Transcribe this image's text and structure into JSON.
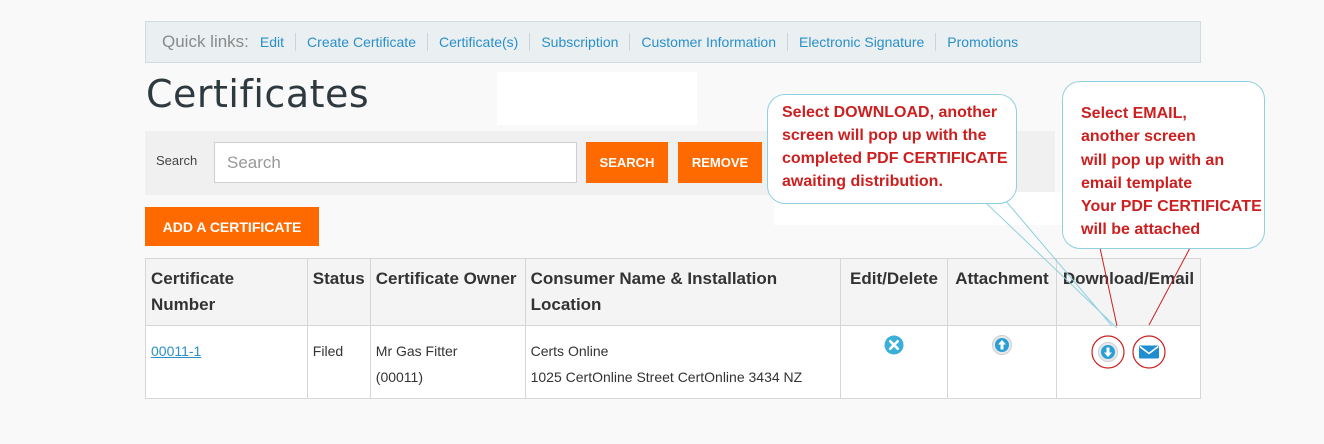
{
  "quick_links": {
    "label": "Quick links:",
    "items": [
      "Edit",
      "Create Certificate",
      "Certificate(s)",
      "Subscription",
      "Customer Information",
      "Electronic Signature",
      "Promotions"
    ]
  },
  "page_title": "Certificates",
  "search": {
    "label": "Search",
    "placeholder": "Search",
    "search_button": "SEARCH",
    "remove_button": "REMOVE"
  },
  "add_button": "ADD A CERTIFICATE",
  "table": {
    "headers": {
      "cert_number": "Certificate Number",
      "status": "Status",
      "owner": "Certificate Owner",
      "consumer": "Consumer Name & Installation Location",
      "edit_delete": "Edit/Delete",
      "attachment": "Attachment",
      "download_email": "Download/Email"
    },
    "rows": [
      {
        "cert_number": "00011-1",
        "status": "Filed",
        "owner_name": "Mr Gas Fitter",
        "owner_id": "(00011)",
        "consumer_name": "Certs Online",
        "consumer_address": "1025 CertOnline Street CertOnline 3434 NZ"
      }
    ]
  },
  "callouts": {
    "download": [
      "Select DOWNLOAD, another",
      "screen will pop up with the",
      "completed PDF CERTIFICATE",
      "awaiting distribution."
    ],
    "email": [
      "Select EMAIL,",
      "another screen",
      "will pop up with an",
      "email template",
      "Your PDF CERTIFICATE",
      "will be attached"
    ]
  },
  "colors": {
    "accent_orange": "#ff6a00",
    "link_blue": "#2a8fc9",
    "callout_text": "#cc1f1f",
    "callout_border": "#8fd0e0"
  },
  "icons": {
    "delete": "delete-circle-icon",
    "attachment": "upload-arrow-icon",
    "download": "download-arrow-icon",
    "email": "envelope-icon"
  }
}
